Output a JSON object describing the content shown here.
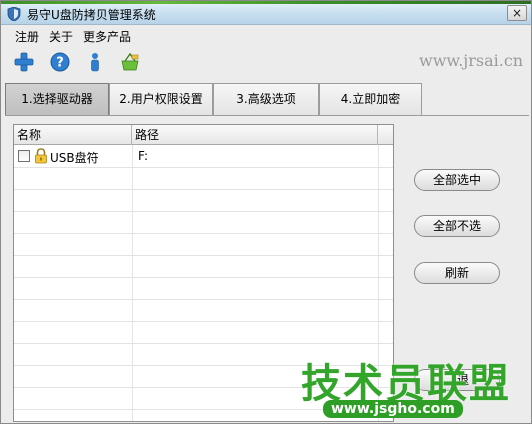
{
  "window": {
    "title": "易守U盘防拷贝管理系统",
    "close_label": "×"
  },
  "menu": {
    "items": [
      {
        "label": "注册"
      },
      {
        "label": "关于"
      },
      {
        "label": "更多产品"
      }
    ]
  },
  "toolbar": {
    "buttons": [
      {
        "icon": "plus-icon"
      },
      {
        "icon": "help-icon"
      },
      {
        "icon": "info-icon"
      },
      {
        "icon": "basket-icon"
      }
    ]
  },
  "watermark": {
    "site_url": "www.jrsai.cn",
    "logo_text": "技术员联盟",
    "logo_url": "www.jsgho.com"
  },
  "tabs": [
    {
      "label": "1.选择驱动器",
      "active": true
    },
    {
      "label": "2.用户权限设置",
      "active": false
    },
    {
      "label": "3.高级选项",
      "active": false
    },
    {
      "label": "4.立即加密",
      "active": false
    }
  ],
  "grid": {
    "columns": [
      "名称",
      "路径"
    ],
    "rows": [
      {
        "checked": false,
        "locked": true,
        "name": "USB盘符",
        "path": "F:"
      }
    ]
  },
  "buttons": {
    "select_all": "全部选中",
    "select_none": "全部不选",
    "refresh": "刷新",
    "partial_bottom": "退"
  },
  "colors": {
    "watermark_green": "#33a52a",
    "title_gradient": "#c9e0f0"
  }
}
